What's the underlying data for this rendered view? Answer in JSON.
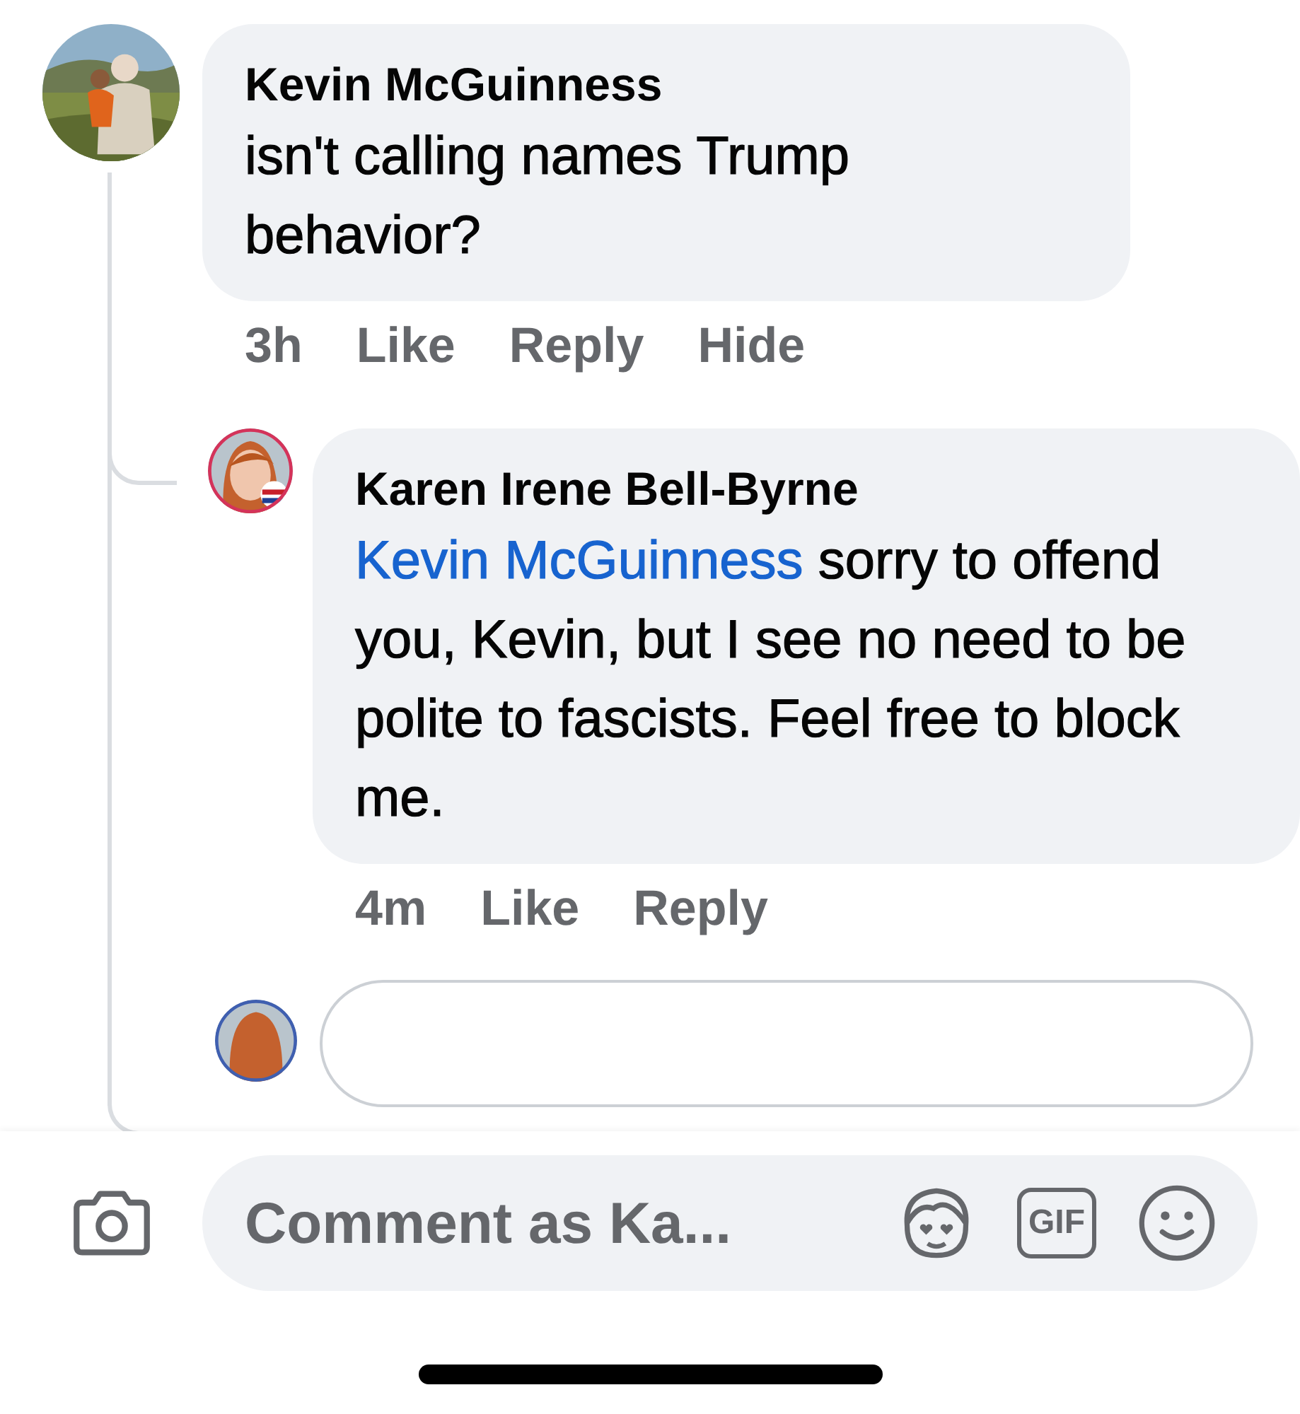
{
  "comments": [
    {
      "author": "Kevin McGuinness",
      "text": "isn't calling names Trump behavior?",
      "time": "3h",
      "actions": [
        "Like",
        "Reply",
        "Hide"
      ],
      "replies": [
        {
          "author": "Karen Irene Bell-Byrne",
          "mention": "Kevin McGuinness",
          "text": "sorry to offend you, Kevin, but I see no need to be polite to fascists. Feel free to block me.",
          "time": "4m",
          "actions": [
            "Like",
            "Reply"
          ]
        }
      ]
    }
  ],
  "composer": {
    "placeholder": "Comment as Ka...",
    "gif_label": "GIF"
  }
}
